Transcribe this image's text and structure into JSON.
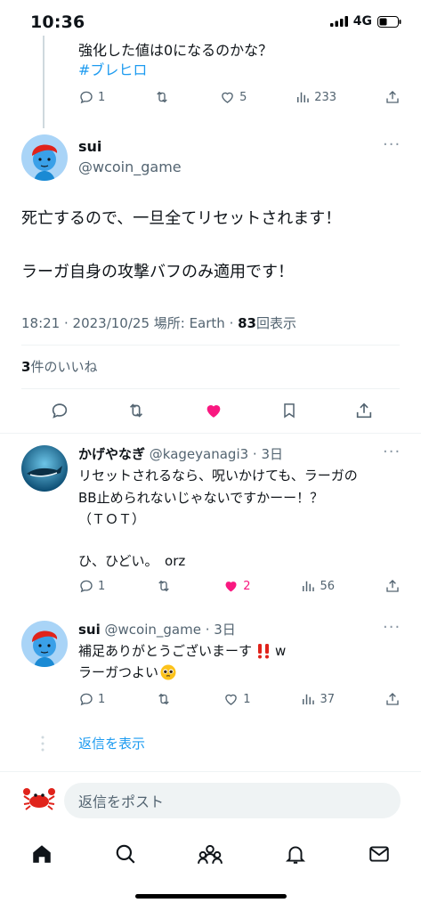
{
  "status": {
    "time": "10:36",
    "network": "4G"
  },
  "prev_tweet": {
    "text_line1": "強化した値は0になるのかな？",
    "hashtag": "#ブレヒロ",
    "replies": "1",
    "retweets": "",
    "likes": "5",
    "views": "233"
  },
  "main_tweet": {
    "display_name": "sui",
    "handle": "@wcoin_game",
    "line1": "死亡するので、一旦全てリセットされます！",
    "line2": "ラーガ自身の攻撃バフのみ適用です！",
    "meta_time": "18:21 · 2023/10/25 場所: Earth · ",
    "views_count": "83",
    "views_label": "回表示",
    "likes_count": "3",
    "likes_label": "件のいいね"
  },
  "reply1": {
    "display_name": "かげやなぎ",
    "handle_age": "@kageyanagi3 · 3日",
    "line1": "リセットされるなら、呪いかけても、ラーガの",
    "line2": "BB止められないじゃないですかーー！？",
    "line3": "（ＴＯＴ）",
    "line4": "ひ、ひどい。　orz",
    "replies": "1",
    "likes": "2",
    "views": "56"
  },
  "reply2": {
    "display_name": "sui",
    "handle_age": "@wcoin_game · 3日",
    "line1": "補足ありがとうございまーす",
    "line1_suffix": "w",
    "line2": "ラーガつよい",
    "replies": "1",
    "likes": "1",
    "views": "37"
  },
  "show_replies": "返信を表示",
  "reply_input": {
    "placeholder": "返信をポスト"
  },
  "colors": {
    "accent": "#1d9bf0",
    "like": "#f91880",
    "muted": "#536471"
  }
}
